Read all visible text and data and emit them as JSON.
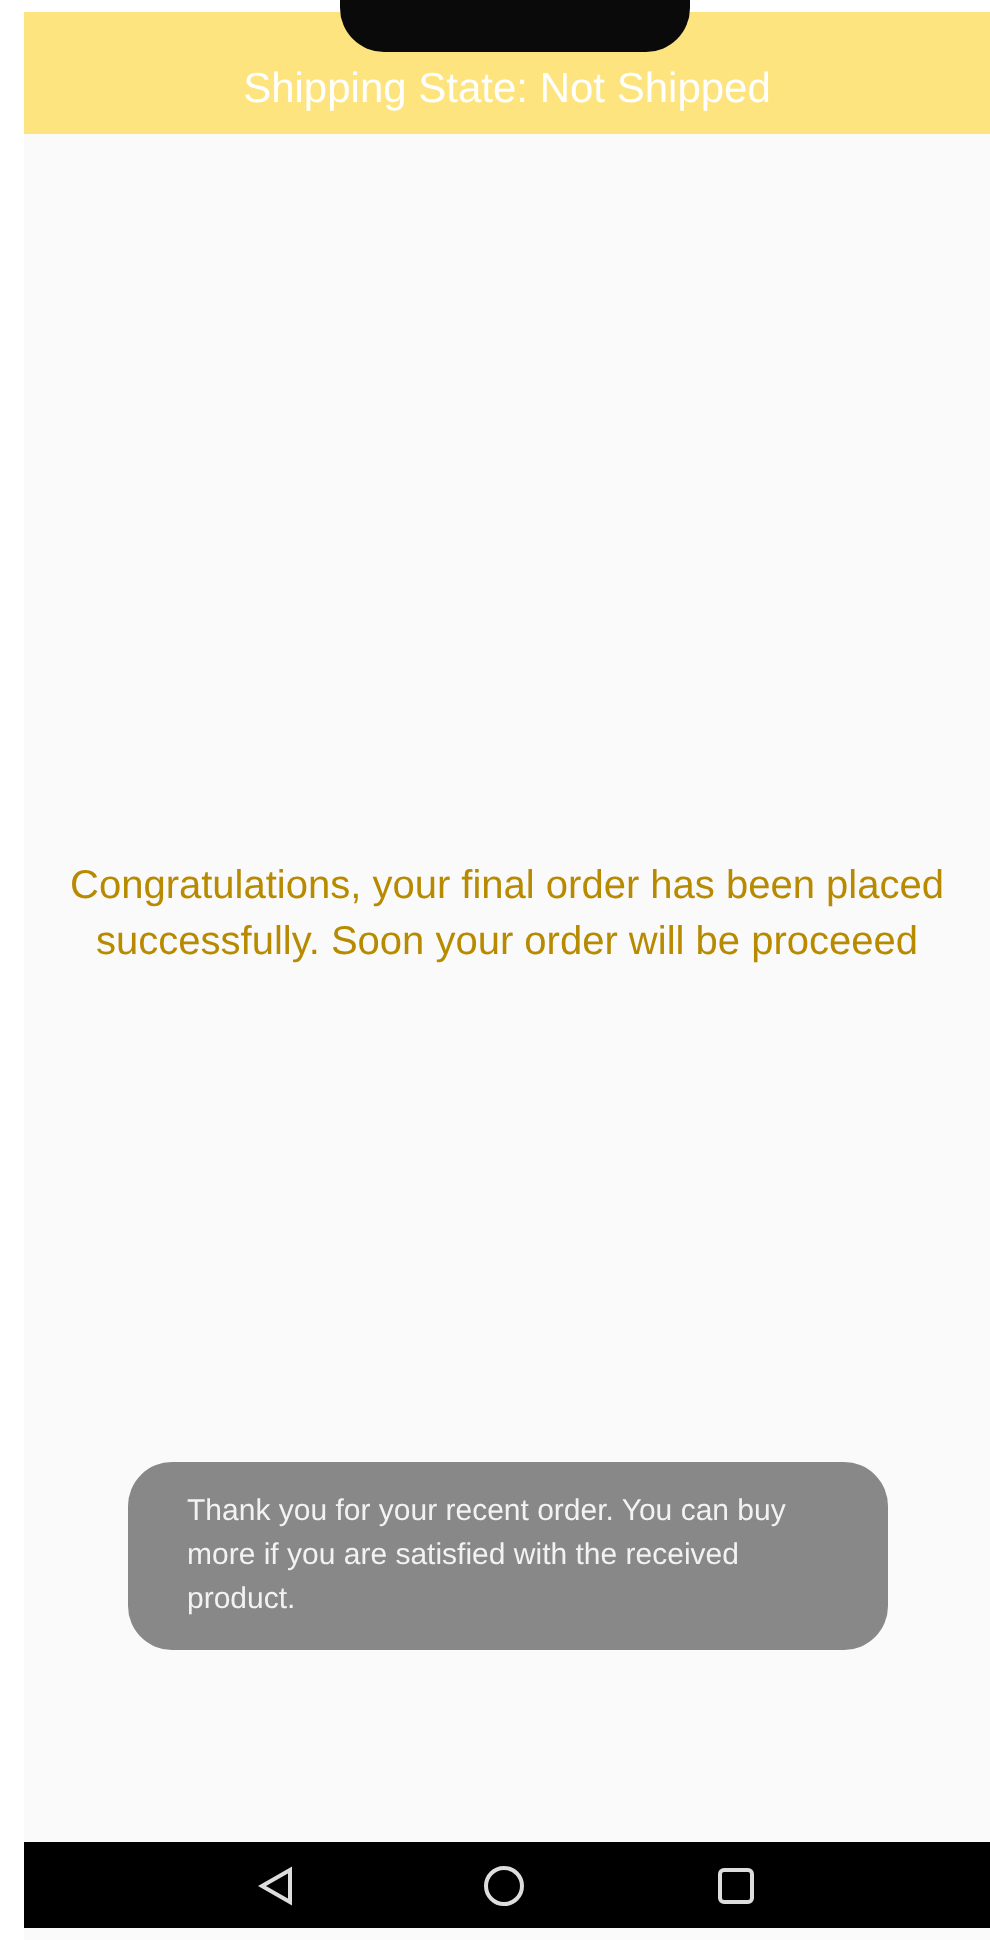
{
  "header": {
    "title": "Shipping State: Not Shipped"
  },
  "message": "Congratulations, your final order has been placed successfully. Soon your order will be proceeed",
  "toast": "Thank you for your recent order. You can buy more if you are satisfied with the received product."
}
